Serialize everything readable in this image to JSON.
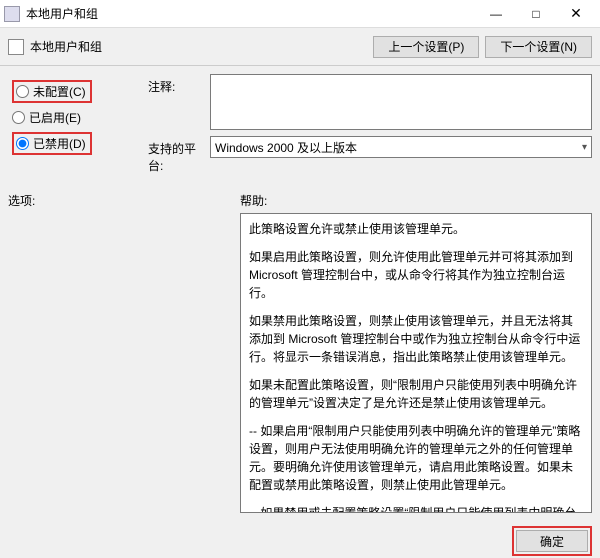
{
  "window": {
    "title": "本地用户和组",
    "minimize": "—",
    "maximize": "□",
    "close": "✕"
  },
  "header": {
    "title": "本地用户和组",
    "prev_btn": "上一个设置(P)",
    "next_btn": "下一个设置(N)"
  },
  "radios": {
    "not_configured": "未配置(C)",
    "enabled": "已启用(E)",
    "disabled": "已禁用(D)"
  },
  "fields": {
    "comment_label": "注释:",
    "platform_label": "支持的平台:",
    "platform_value": "Windows 2000 及以上版本"
  },
  "lower": {
    "options_label": "选项:",
    "help_label": "帮助:"
  },
  "help_paragraphs": [
    "此策略设置允许或禁止使用该管理单元。",
    "如果启用此策略设置，则允许使用此管理单元并可将其添加到 Microsoft 管理控制台中，或从命令行将其作为独立控制台运行。",
    "如果禁用此策略设置，则禁止使用该管理单元，并且无法将其添加到 Microsoft 管理控制台中或作为独立控制台从命令行中运行。将显示一条错误消息，指出此策略禁止使用该管理单元。",
    "如果未配置此策略设置，则“限制用户只能使用列表中明确允许的管理单元”设置决定了是允许还是禁止使用该管理单元。",
    "-- 如果启用“限制用户只能使用列表中明确允许的管理单元”策略设置，则用户无法使用明确允许的管理单元之外的任何管理单元。要明确允许使用该管理单元，请启用此策略设置。如果未配置或禁用此策略设置，则禁止使用此管理单元。",
    "-- 如果禁用或未配置策略设置“限制用户只能使用列表中明确允许的管理单元”，则用户可以使用除了明确禁止的管理单元之外的任何管理单元。"
  ],
  "buttons": {
    "ok": "确定"
  }
}
